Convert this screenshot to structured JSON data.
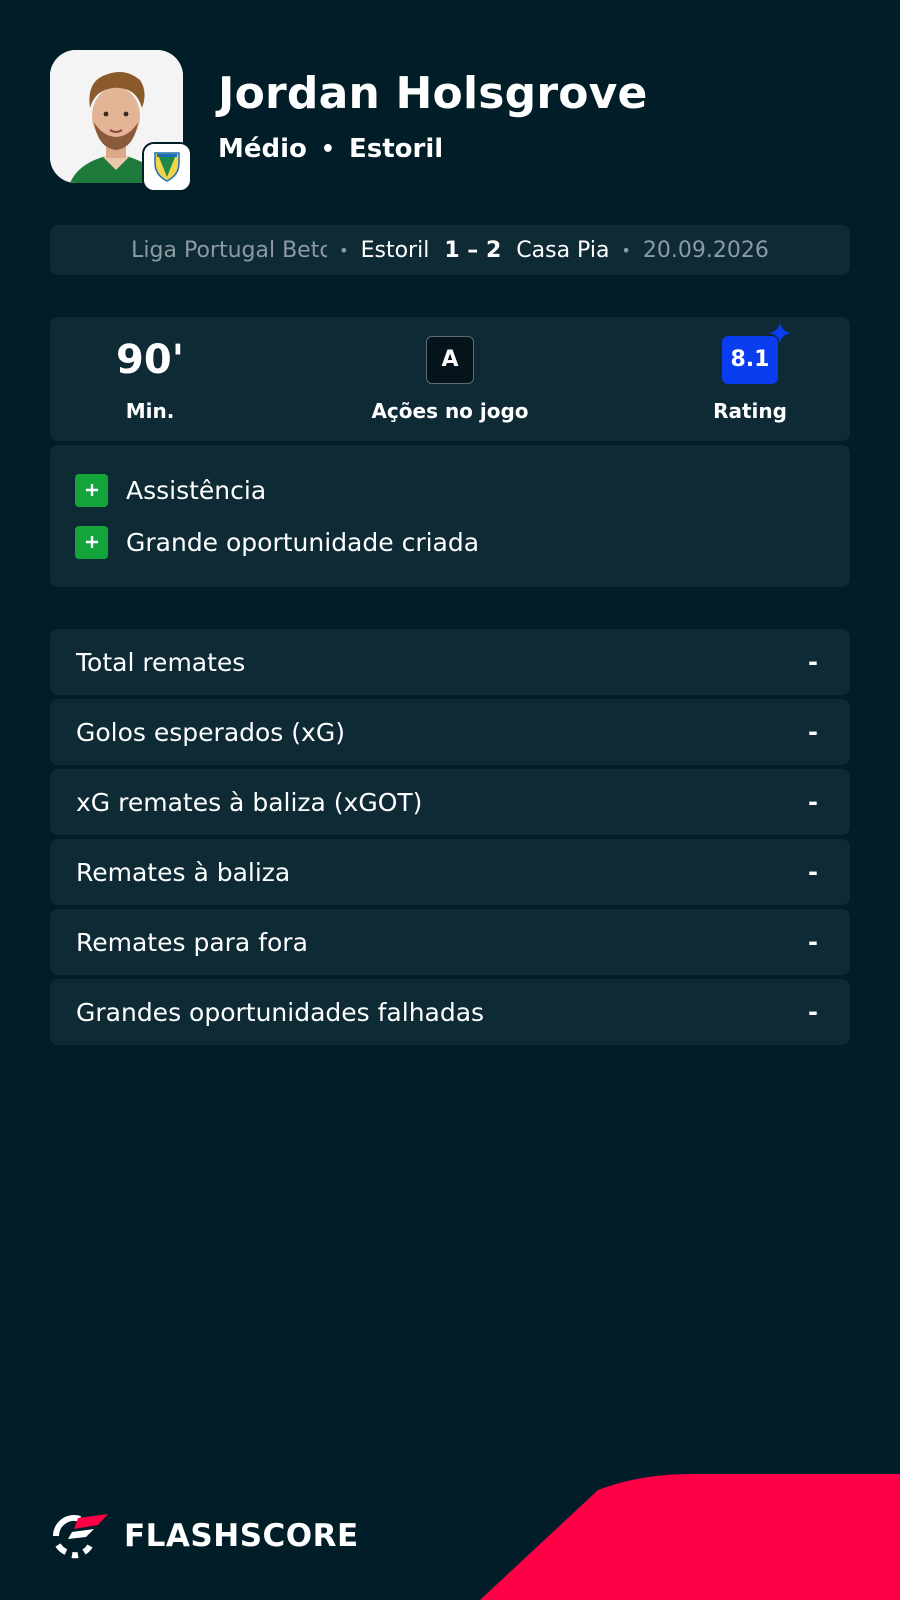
{
  "player": {
    "name": "Jordan Holsgrove",
    "position": "Médio",
    "club": "Estoril"
  },
  "match": {
    "league": "Liga Portugal Betclic",
    "home_team": "Estoril",
    "score": "1 – 2",
    "away_team": "Casa Pia",
    "date": "20.09.2026"
  },
  "summary": {
    "minutes_value": "90'",
    "minutes_label": "Min.",
    "actions_value": "A",
    "actions_label": "Ações no jogo",
    "rating_value": "8.1",
    "rating_label": "Rating"
  },
  "events": [
    {
      "label": "Assistência"
    },
    {
      "label": "Grande oportunidade criada"
    }
  ],
  "stats": [
    {
      "label": "Total remates",
      "value": "-"
    },
    {
      "label": "Golos esperados (xG)",
      "value": "-"
    },
    {
      "label": "xG remates à baliza (xGOT)",
      "value": "-"
    },
    {
      "label": "Remates à baliza",
      "value": "-"
    },
    {
      "label": "Remates para fora",
      "value": "-"
    },
    {
      "label": "Grandes oportunidades falhadas",
      "value": "-"
    }
  ],
  "footer": {
    "brand": "FLASHSCORE"
  },
  "colors": {
    "background": "#011e28",
    "card": "#0e2a35",
    "rating": "#0a3cf0",
    "event_plus": "#14a43c",
    "accent_red": "#ff0046"
  },
  "icons": {
    "event_icon": "plus-icon",
    "rating_icon": "sparkle-icon",
    "brand_icon": "flashscore-logo-icon"
  }
}
